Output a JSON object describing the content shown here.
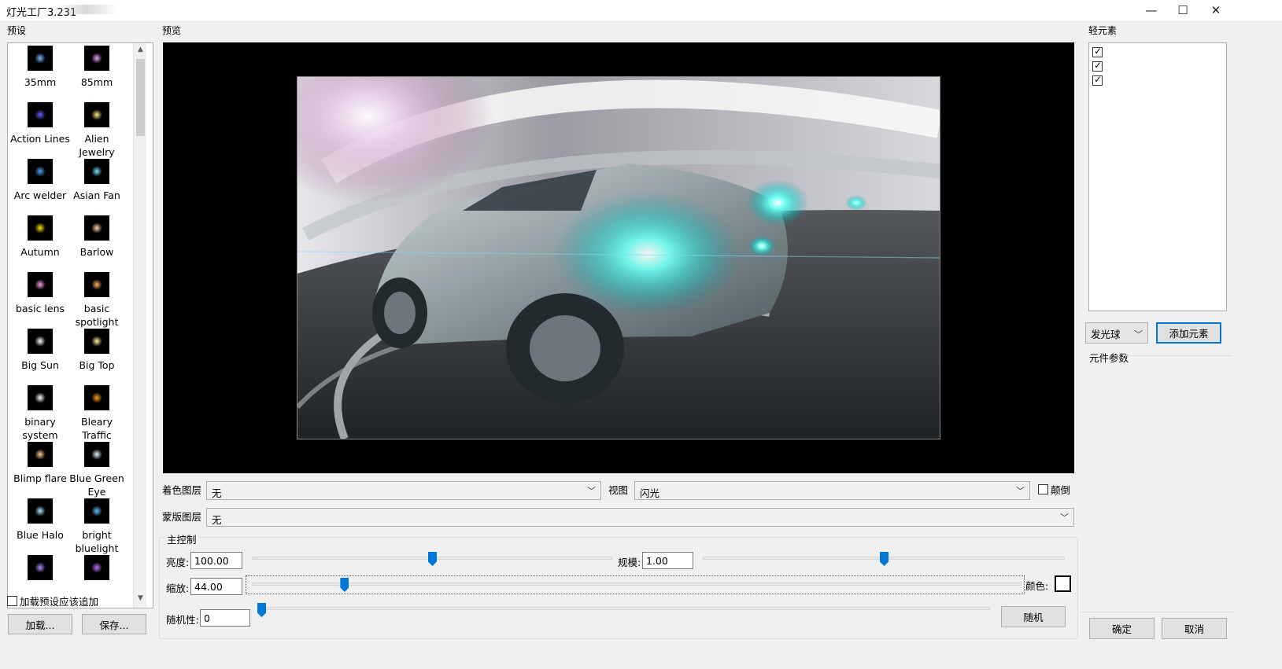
{
  "window": {
    "title": "灯光工厂3.231",
    "minimize_icon": "—",
    "maximize_icon": "☐",
    "close_icon": "✕"
  },
  "presets": {
    "label": "预设",
    "items": [
      {
        "name": "35mm",
        "color": "#7ab8ff"
      },
      {
        "name": "85mm",
        "color": "#e6a0ff"
      },
      {
        "name": "Action Lines",
        "color": "#6b5cff"
      },
      {
        "name": "Alien\nJewelry",
        "color": "#ffe680"
      },
      {
        "name": "Arc welder",
        "color": "#4aa2ff"
      },
      {
        "name": "Asian Fan",
        "color": "#77e0ff"
      },
      {
        "name": "Autumn",
        "color": "#ffe600"
      },
      {
        "name": "Barlow",
        "color": "#ffd9a0"
      },
      {
        "name": "basic lens",
        "color": "#ff9adf"
      },
      {
        "name": "basic\nspotlight",
        "color": "#ffb060"
      },
      {
        "name": "Big Sun",
        "color": "#ffffff"
      },
      {
        "name": "Big Top",
        "color": "#fff1a0"
      },
      {
        "name": "binary\nsystem",
        "color": "#ffffff"
      },
      {
        "name": "Bleary\nTraffic",
        "color": "#ff9a20"
      },
      {
        "name": "Blimp flare",
        "color": "#ffcf90"
      },
      {
        "name": "Blue Green\nEye",
        "color": "#e0f7ff"
      },
      {
        "name": "Blue Halo",
        "color": "#b0e4ff"
      },
      {
        "name": "bright\nbluelight",
        "color": "#5fc1ff"
      },
      {
        "name": "",
        "color": "#b38cff"
      },
      {
        "name": "",
        "color": "#c070ff"
      }
    ],
    "append_checkbox_label": "加载预设应该追加",
    "load_button": "加载...",
    "save_button": "保存..."
  },
  "preview": {
    "label": "预览"
  },
  "controls": {
    "color_layer_label": "着色图层",
    "color_layer_value": "无",
    "view_label": "视图",
    "view_value": "闪光",
    "flip_label": "颠倒",
    "mask_layer_label": "蒙版图层",
    "mask_layer_value": "无",
    "main_group_label": "主控制",
    "brightness_label": "亮度:",
    "brightness_value": "100.00",
    "brightness_level": 0.5,
    "scale_label": "规模:",
    "scale_value": "1.00",
    "scale_level": 0.5,
    "zoom_label": "缩放:",
    "zoom_value": "44.00",
    "zoom_level": 0.12,
    "color_label": "颜色:",
    "random_label": "随机性:",
    "random_value": "0",
    "random_level": 0.0,
    "random_button": "随机"
  },
  "elements": {
    "label": "轻元素",
    "checked_count": 3,
    "element_type_value": "发光球",
    "add_button": "添加元素",
    "params_label": "元件参数"
  },
  "dialog": {
    "ok_button": "确定",
    "cancel_button": "取消"
  }
}
